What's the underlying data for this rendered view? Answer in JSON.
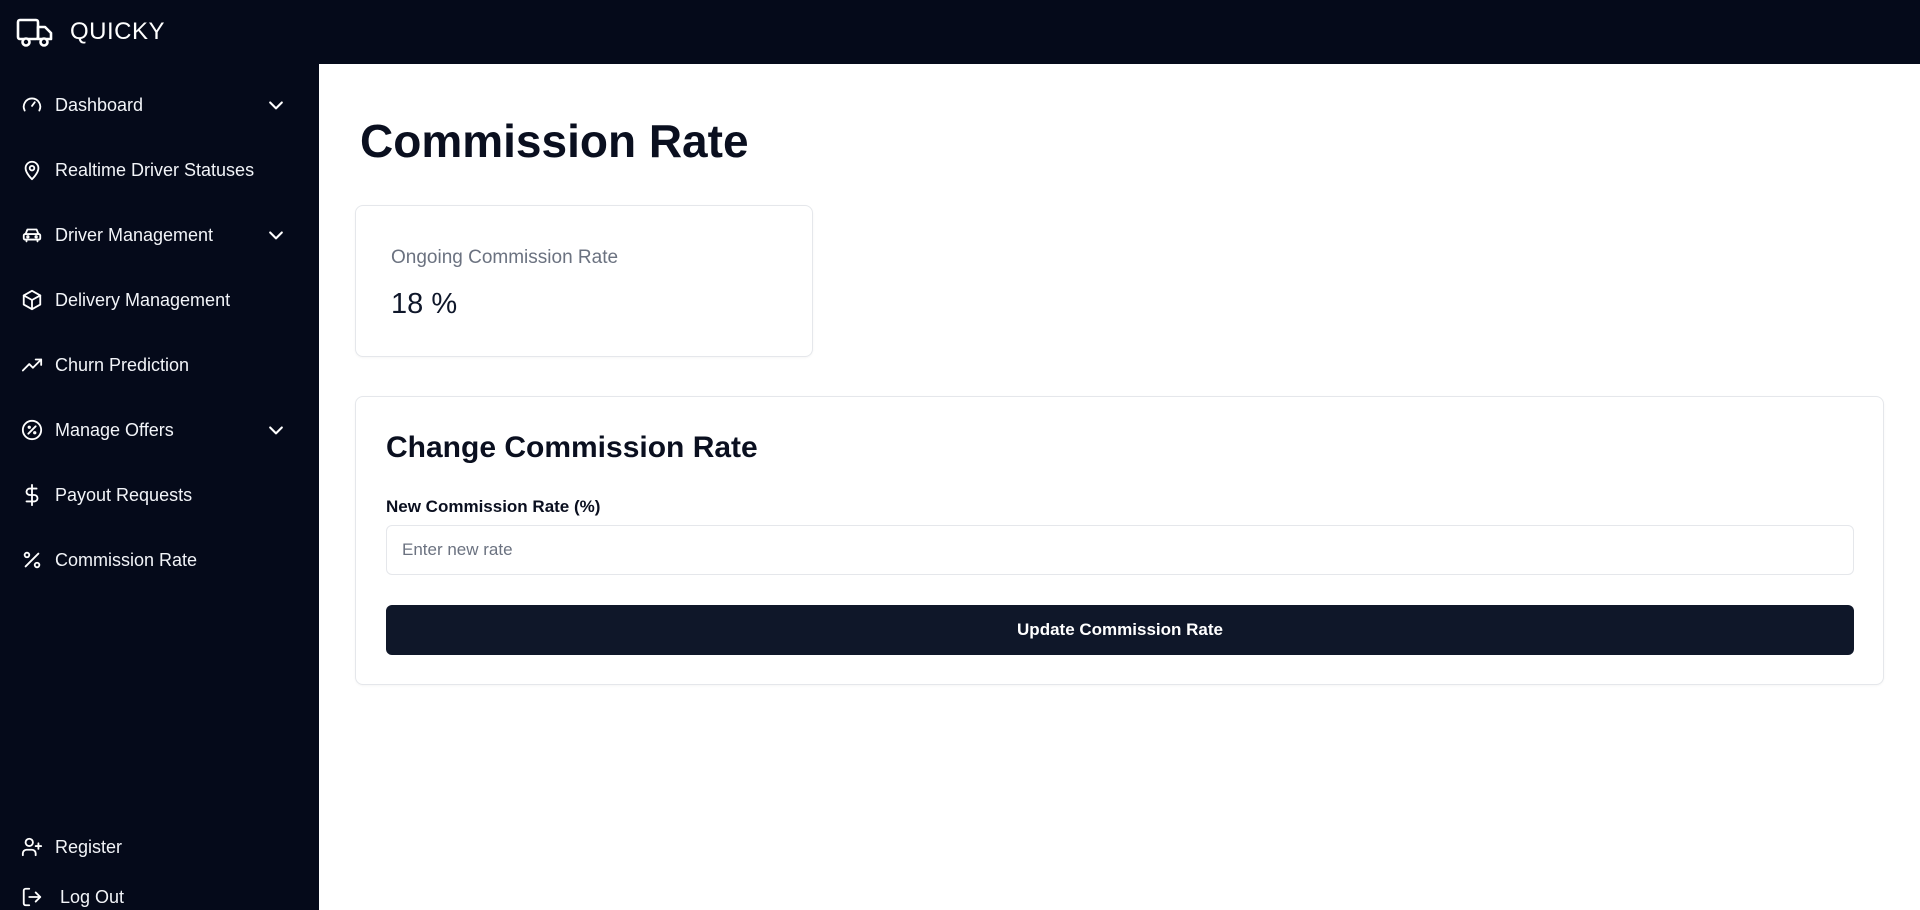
{
  "app": {
    "name": "QUICKY",
    "logo_icon": "truck-icon"
  },
  "sidebar": {
    "items": [
      {
        "label": "Dashboard",
        "icon": "gauge-icon",
        "has_submenu": true
      },
      {
        "label": "Realtime Driver Statuses",
        "icon": "map-pin-icon",
        "has_submenu": false
      },
      {
        "label": "Driver Management",
        "icon": "car-icon",
        "has_submenu": true
      },
      {
        "label": "Delivery Management",
        "icon": "package-icon",
        "has_submenu": false
      },
      {
        "label": "Churn Prediction",
        "icon": "trend-icon",
        "has_submenu": false
      },
      {
        "label": "Manage Offers",
        "icon": "offer-badge-icon",
        "has_submenu": true
      },
      {
        "label": "Payout Requests",
        "icon": "dollar-icon",
        "has_submenu": false
      },
      {
        "label": "Commission Rate",
        "icon": "percent-icon",
        "has_submenu": false
      }
    ],
    "footer": [
      {
        "label": "Register",
        "icon": "user-plus-icon"
      },
      {
        "label": "Log Out",
        "icon": "logout-icon"
      }
    ]
  },
  "main": {
    "title": "Commission Rate",
    "current_rate": {
      "label": "Ongoing Commission Rate",
      "value": "18 %"
    },
    "form": {
      "title": "Change Commission Rate",
      "field_label": "New Commission Rate (%)",
      "placeholder": "Enter new rate",
      "value": "",
      "submit_label": "Update Commission Rate"
    }
  },
  "colors": {
    "sidebar_bg": "#050a1a",
    "button_bg": "#0f1729",
    "muted_text": "#6b7280"
  }
}
